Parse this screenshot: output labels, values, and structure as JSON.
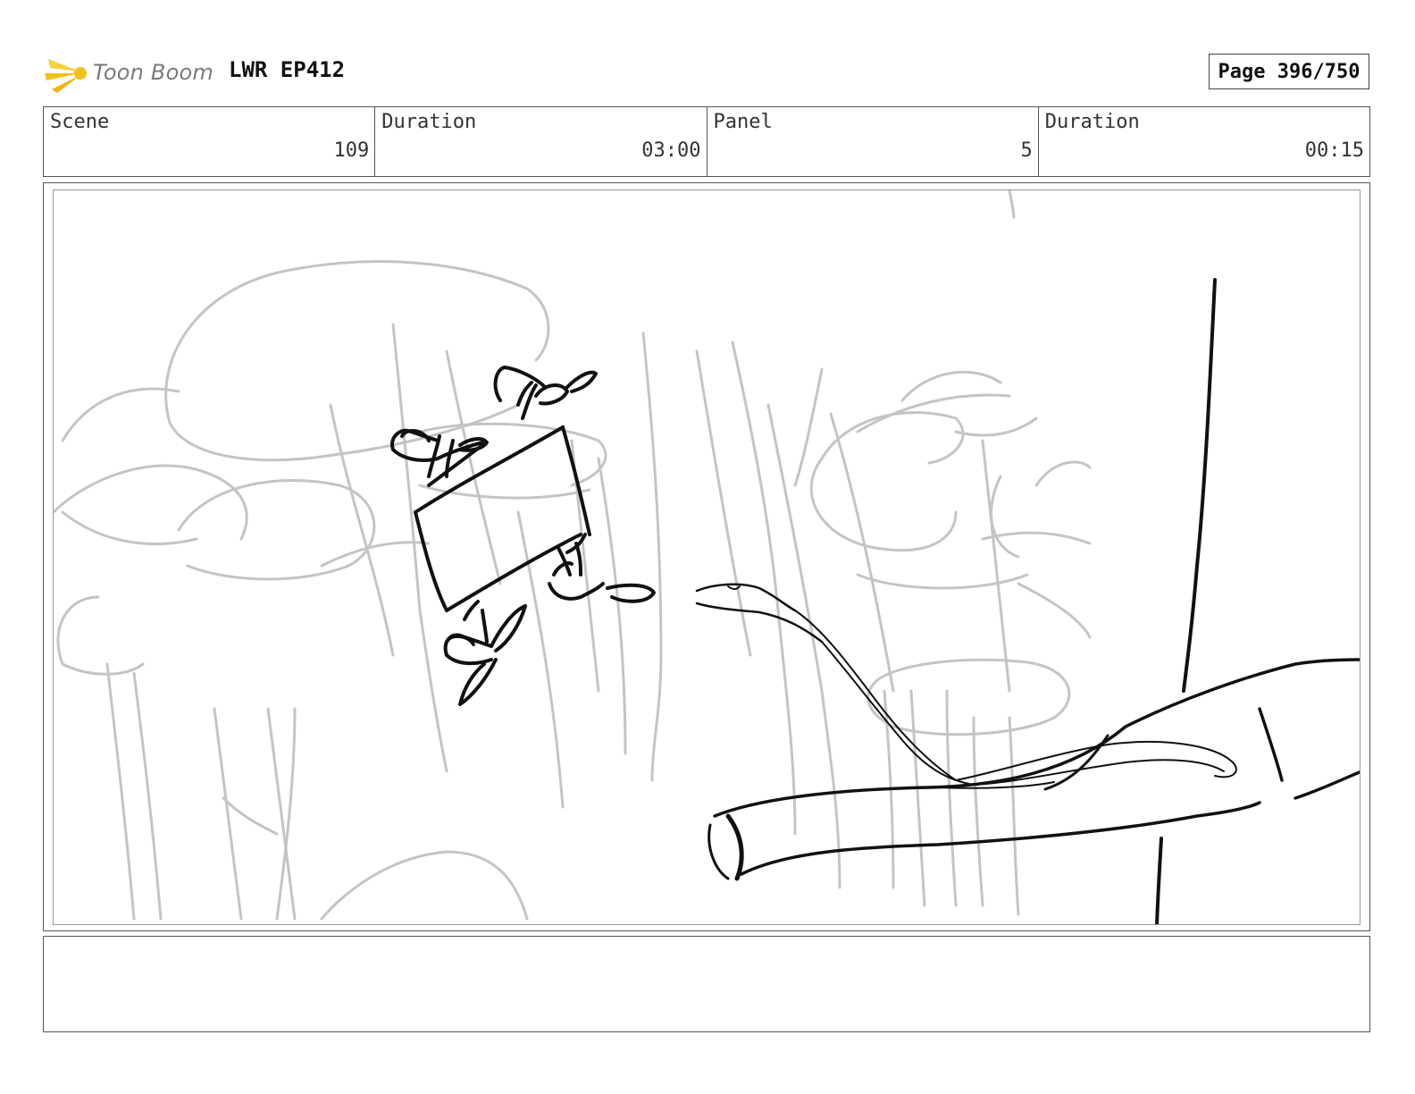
{
  "header": {
    "logo_text": "Toon Boom",
    "title": "LWR EP412",
    "page_label": "Page 396/750"
  },
  "info": {
    "scene_label": "Scene",
    "scene_value": "109",
    "scene_duration_label": "Duration",
    "scene_duration_value": "03:00",
    "panel_label": "Panel",
    "panel_value": "5",
    "panel_duration_label": "Duration",
    "panel_duration_value": "00:15"
  },
  "notes": {
    "text": ""
  },
  "colors": {
    "logo_star": "#f2c11b",
    "logo_text": "#7a7a7a",
    "sketch_rough": "#c4c4c4",
    "sketch_ink": "#111111"
  }
}
